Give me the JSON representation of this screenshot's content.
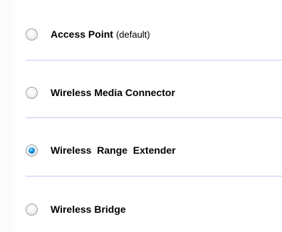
{
  "mode_selector": {
    "options": [
      {
        "label": "Access Point",
        "suffix": "(default)",
        "selected": false
      },
      {
        "label": "Wireless Media Connector",
        "suffix": "",
        "selected": false
      },
      {
        "label": "Wireless  Range  Extender",
        "suffix": "",
        "selected": true
      },
      {
        "label": "Wireless Bridge",
        "suffix": "",
        "selected": false
      }
    ]
  },
  "colors": {
    "divider": "#c6c8f0",
    "radio_selected": "#1d9be8",
    "text": "#000000"
  }
}
